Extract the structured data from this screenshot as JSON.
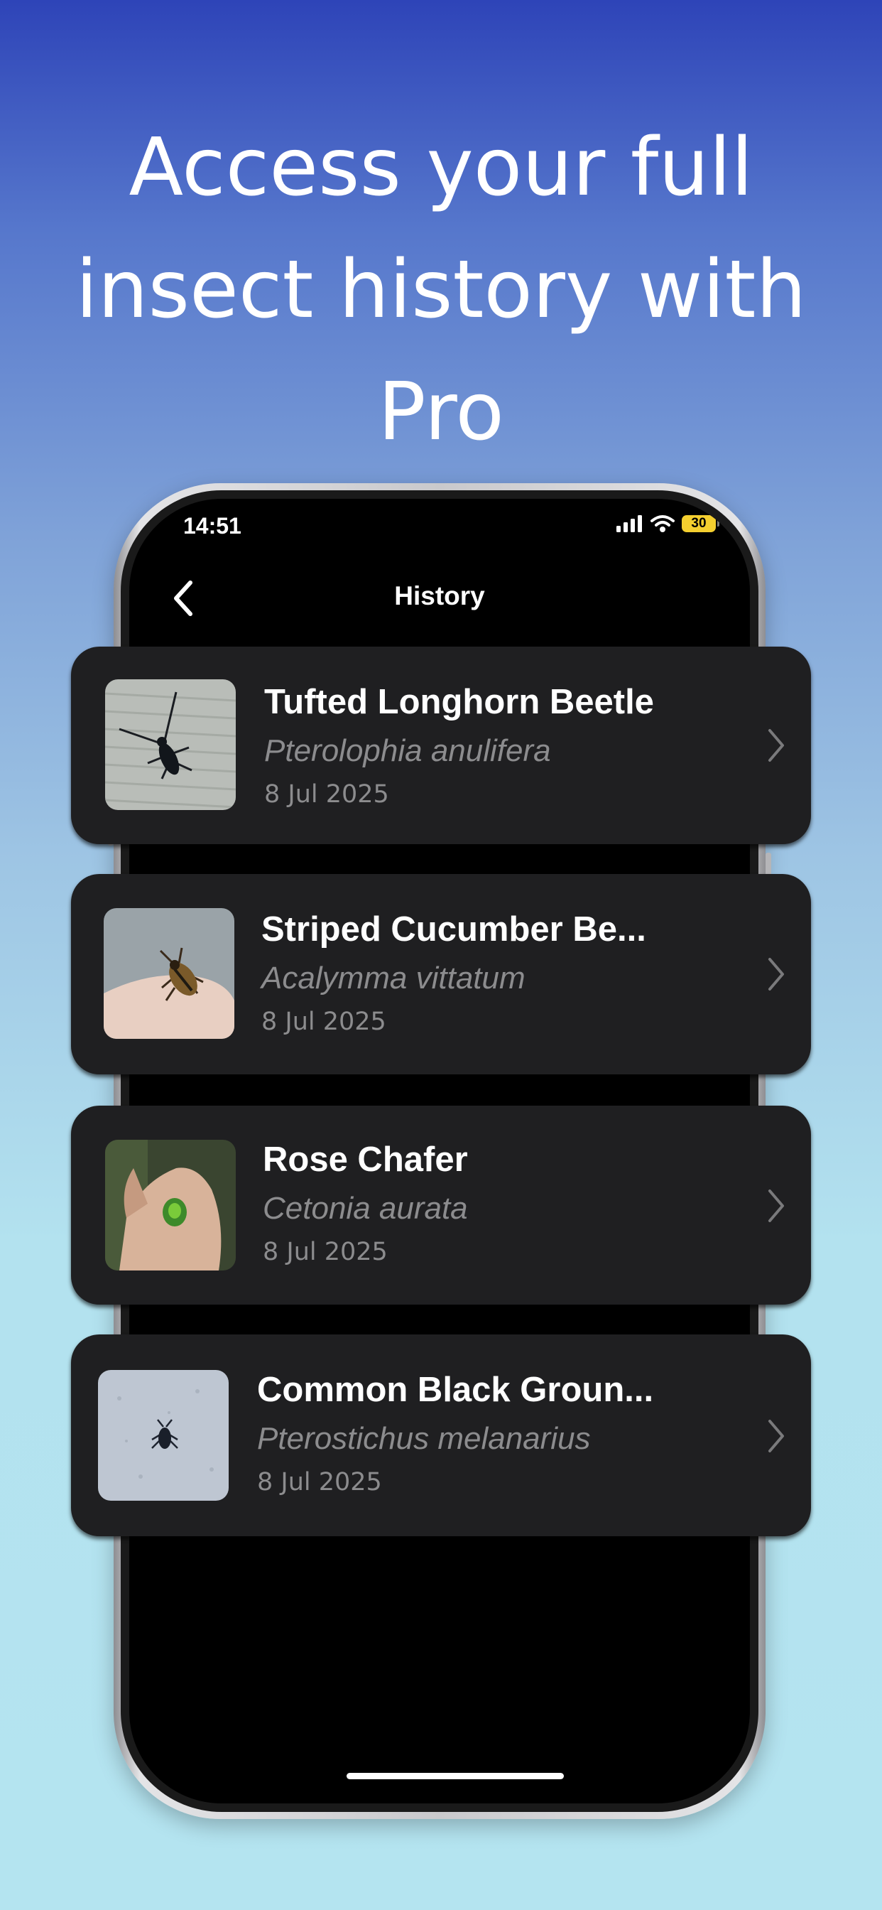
{
  "headline": {
    "line1": "Access your full",
    "line2": "insect history with",
    "line3": "Pro"
  },
  "status_bar": {
    "time": "14:51",
    "battery": "30",
    "icons": [
      "signal-icon",
      "wifi-icon",
      "battery-icon"
    ]
  },
  "nav": {
    "title": "History",
    "back_icon": "chevron-left-icon"
  },
  "history": [
    {
      "common_name": "Tufted Longhorn Beetle",
      "scientific_name": "Pterolophia anulifera",
      "date": "8 Jul 2025",
      "thumb": "longhorn-beetle-photo"
    },
    {
      "common_name": "Striped Cucumber Be...",
      "scientific_name": "Acalymma vittatum",
      "date": "8 Jul 2025",
      "thumb": "cucumber-beetle-photo"
    },
    {
      "common_name": "Rose Chafer",
      "scientific_name": "Cetonia aurata",
      "date": "8 Jul 2025",
      "thumb": "rose-chafer-photo"
    },
    {
      "common_name": "Common Black Groun...",
      "scientific_name": "Pterostichus melanarius",
      "date": "8 Jul 2025",
      "thumb": "ground-beetle-photo"
    }
  ],
  "colors": {
    "card_bg": "#1f1f21",
    "secondary_text": "#8c8c8e",
    "battery": "#f4cf2f",
    "gradient_top": "#2e44b8",
    "gradient_bottom": "#b4e4f0"
  }
}
